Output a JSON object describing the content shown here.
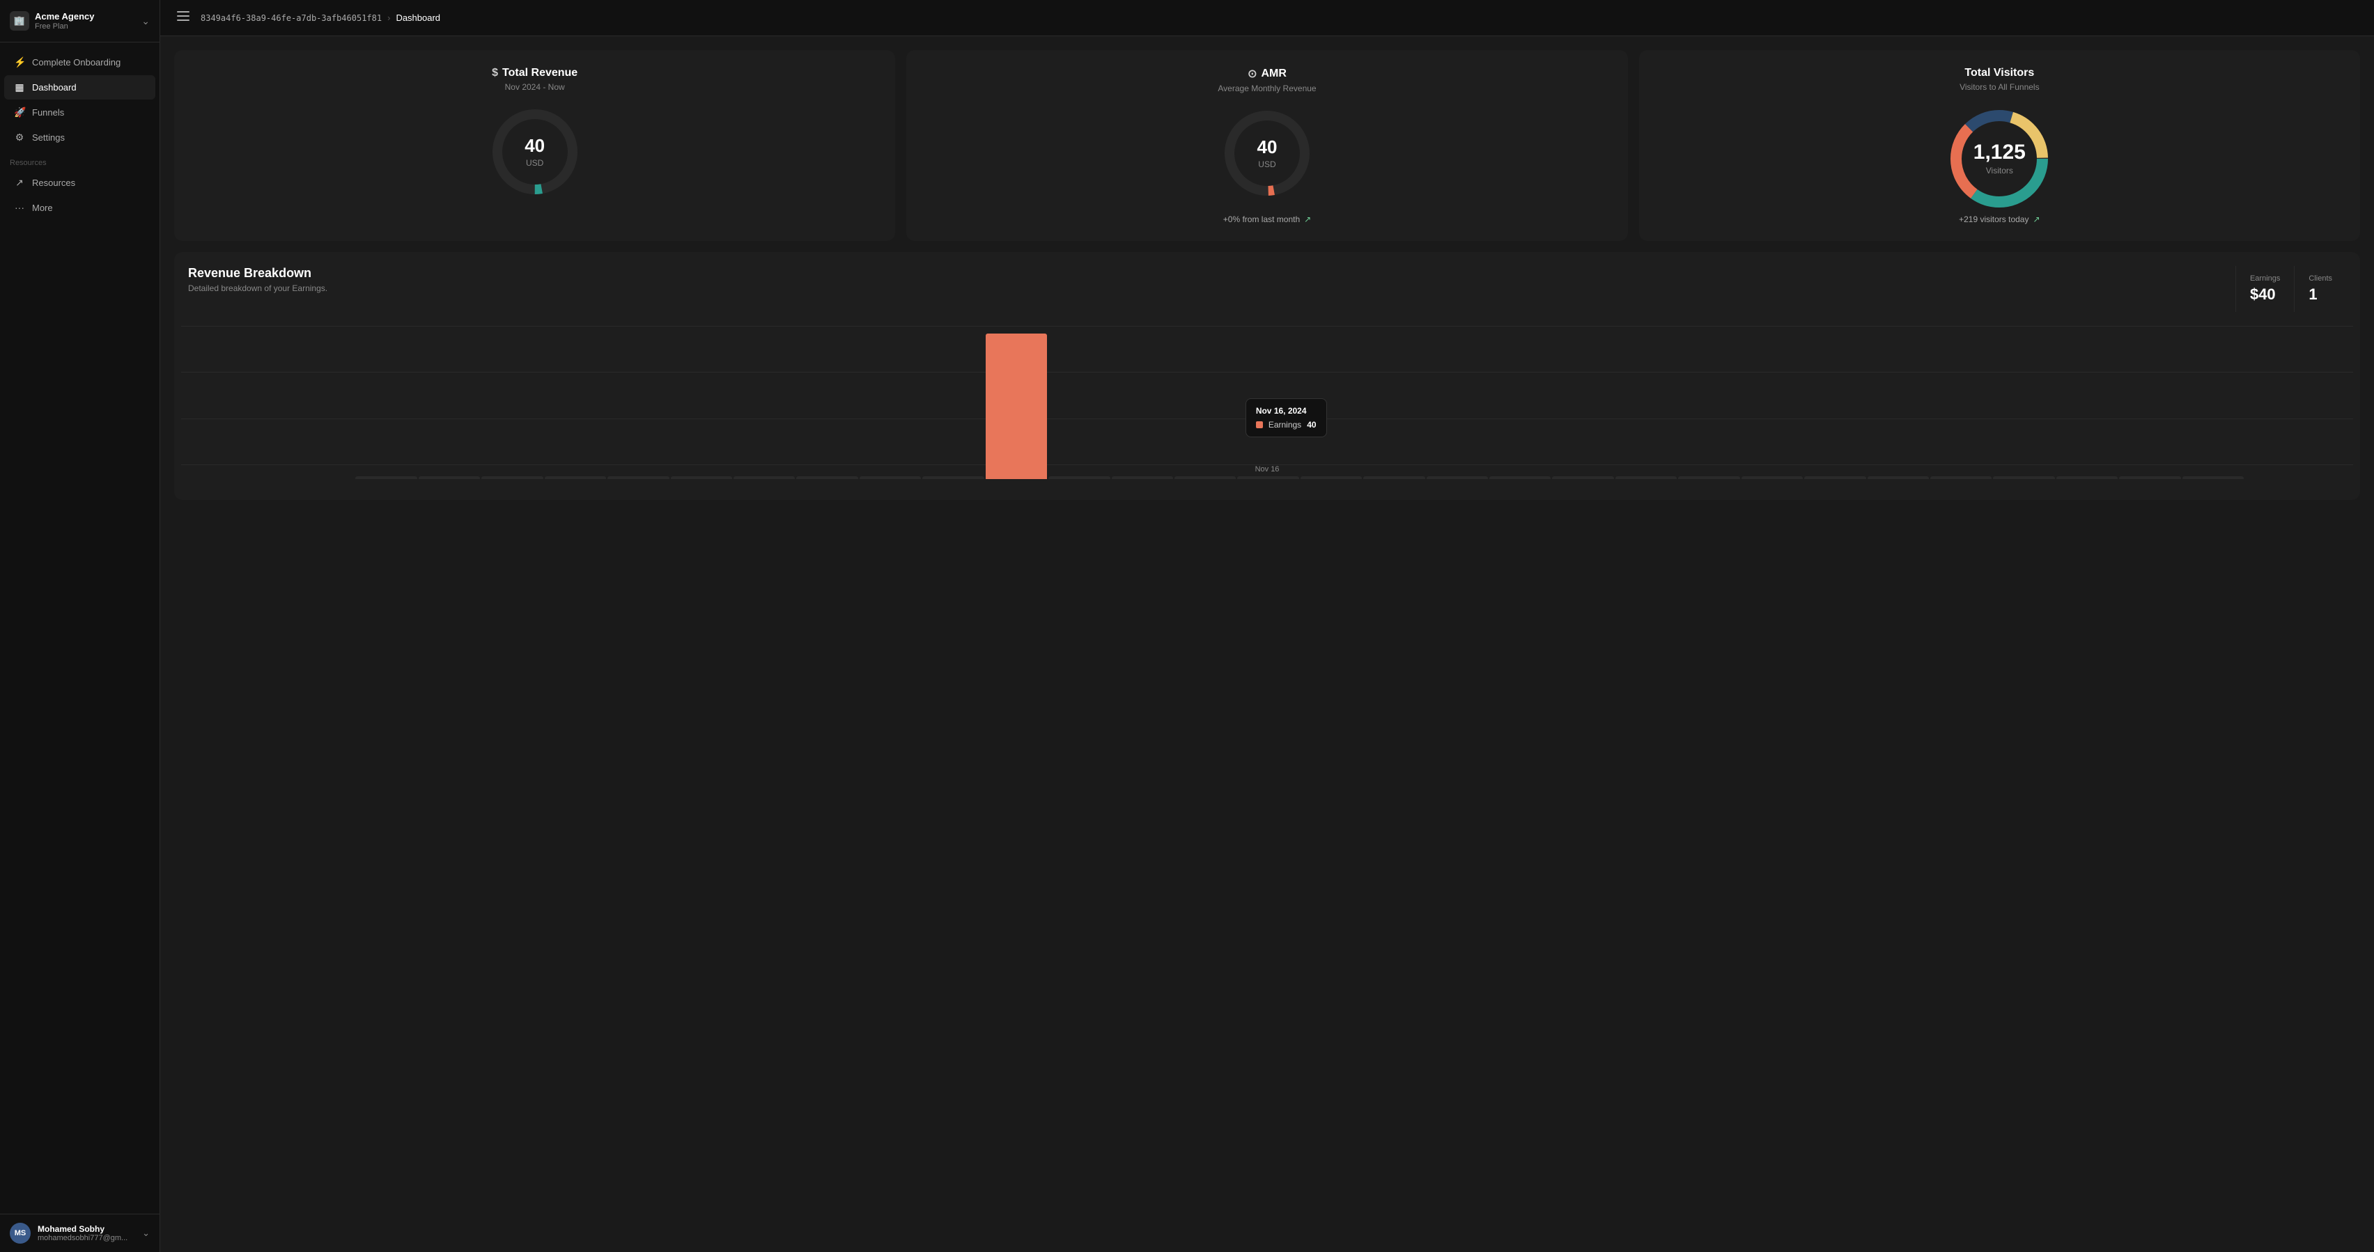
{
  "sidebar": {
    "brand": {
      "name": "Acme Agency",
      "plan": "Free Plan"
    },
    "logo_text": "🏢",
    "nav_items": [
      {
        "id": "onboarding",
        "label": "Complete Onboarding",
        "icon": "⚡",
        "active": false
      },
      {
        "id": "dashboard",
        "label": "Dashboard",
        "icon": "📊",
        "active": true
      },
      {
        "id": "funnels",
        "label": "Funnels",
        "icon": "🚀",
        "active": false
      },
      {
        "id": "settings",
        "label": "Settings",
        "icon": "⚙️",
        "active": false
      }
    ],
    "resources_label": "Resources",
    "resource_items": [
      {
        "id": "resources",
        "label": "Resources",
        "icon": "↗"
      },
      {
        "id": "more",
        "label": "More",
        "icon": "···"
      }
    ],
    "user": {
      "initials": "MS",
      "name": "Mohamed Sobhy",
      "email": "mohamedsobhi777@gm..."
    }
  },
  "topbar": {
    "breadcrumb_id": "8349a4f6-38a9-46fe-a7db-3afb46051f81",
    "breadcrumb_current": "Dashboard",
    "sidebar_toggle_title": "Toggle sidebar"
  },
  "metrics": {
    "total_revenue": {
      "title": "Total Revenue",
      "title_icon": "$",
      "subtitle": "Nov 2024 - Now",
      "value": "40",
      "unit": "USD"
    },
    "amr": {
      "title": "AMR",
      "title_icon": "⊙",
      "subtitle": "Average Monthly Revenue",
      "value": "40",
      "unit": "USD",
      "footer": "+0% from last month"
    },
    "total_visitors": {
      "title": "Total Visitors",
      "subtitle": "Visitors to All Funnels",
      "value": "1,125",
      "unit": "Visitors",
      "footer": "+219 visitors today",
      "donut": {
        "segments": [
          {
            "color": "#2a9d8f",
            "percent": 35
          },
          {
            "color": "#e76f51",
            "percent": 28
          },
          {
            "color": "#2c4a6e",
            "percent": 17
          },
          {
            "color": "#e9c46a",
            "percent": 20
          }
        ]
      }
    }
  },
  "revenue_breakdown": {
    "title": "Revenue Breakdown",
    "subtitle": "Detailed breakdown of your Earnings.",
    "earnings_label": "Earnings",
    "earnings_value": "$40",
    "clients_label": "Clients",
    "clients_value": "1",
    "tooltip": {
      "date": "Nov 16, 2024",
      "metric_label": "Earnings",
      "metric_value": "40"
    },
    "x_label": "Nov 16",
    "bar_data": [
      0,
      0,
      0,
      0,
      0,
      0,
      0,
      0,
      0,
      0,
      100,
      0,
      0,
      0,
      0,
      0,
      0,
      0,
      0,
      0,
      0,
      0,
      0,
      0,
      0,
      0,
      0,
      0,
      0,
      0
    ]
  }
}
